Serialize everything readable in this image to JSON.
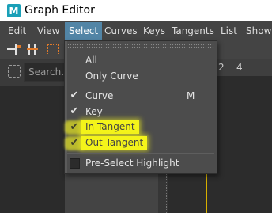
{
  "window": {
    "title": "Graph Editor",
    "app_icon_letter": "M"
  },
  "menubar": {
    "items": [
      {
        "label": "Edit"
      },
      {
        "label": "View"
      },
      {
        "label": "Select"
      },
      {
        "label": "Curves"
      },
      {
        "label": "Keys"
      },
      {
        "label": "Tangents"
      },
      {
        "label": "List"
      },
      {
        "label": "Show"
      }
    ]
  },
  "outliner": {
    "search_placeholder": "Search..."
  },
  "ruler": {
    "ticks": [
      "2",
      "4"
    ]
  },
  "select_menu": {
    "items": [
      {
        "label": "All"
      },
      {
        "label": "Only Curve"
      },
      {
        "label": "Curve",
        "checked": true,
        "shortcut": "M"
      },
      {
        "label": "Key",
        "checked": true
      },
      {
        "label": "In Tangent",
        "checked": true,
        "highlighted": true
      },
      {
        "label": "Out Tangent",
        "checked": true,
        "highlighted": true
      },
      {
        "label": "Pre-Select Highlight",
        "checked": false
      }
    ],
    "check_glyph": "✔"
  },
  "colors": {
    "highlight": "#f4f41a",
    "menu_active": "#5285a6",
    "time_marker": "#d7b000"
  }
}
